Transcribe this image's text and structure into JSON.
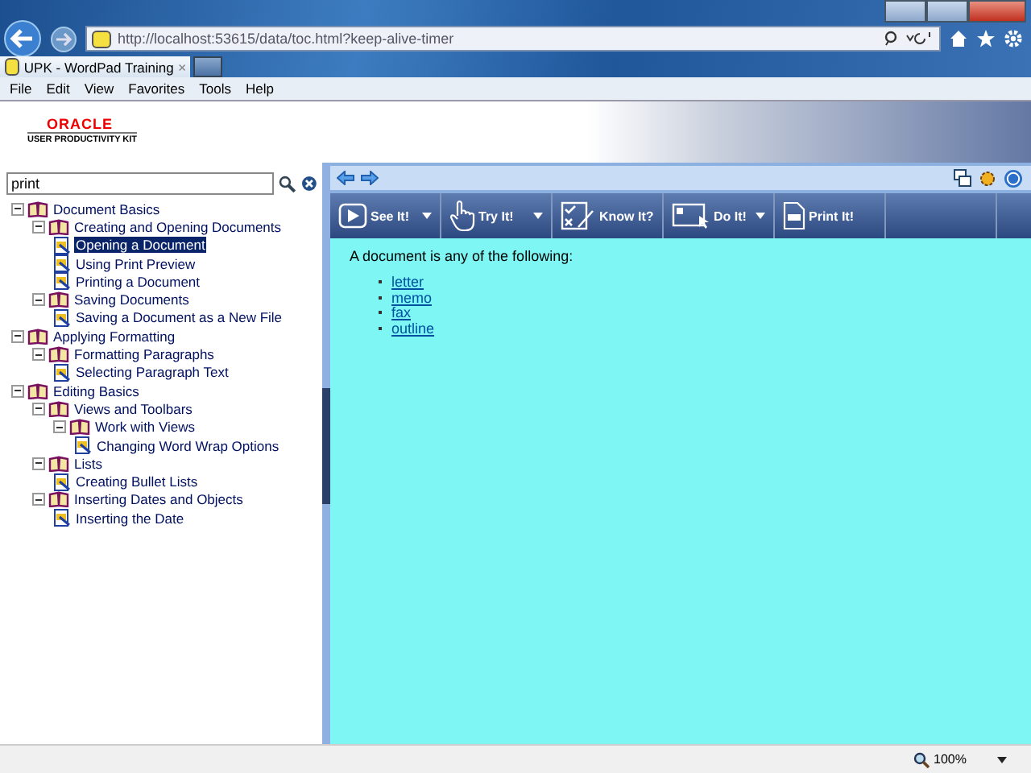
{
  "browser": {
    "address": "http://localhost:53615/data/toc.html?keep-alive-timer",
    "tab_title": "UPK - WordPad Training",
    "menu": [
      "File",
      "Edit",
      "View",
      "Favorites",
      "Tools",
      "Help"
    ]
  },
  "banner": {
    "logo": "ORACLE",
    "subtitle": "USER PRODUCTIVITY KIT"
  },
  "search": {
    "value": "print"
  },
  "tree": [
    {
      "label": "Document Basics",
      "kind": "book",
      "expanded": true,
      "selected": false,
      "children": [
        {
          "label": "Creating and Opening Documents",
          "kind": "book",
          "expanded": true,
          "selected": false,
          "children": [
            {
              "label": "Opening a Document",
              "kind": "topic",
              "selected": true
            },
            {
              "label": "Using Print Preview",
              "kind": "topic",
              "selected": false
            },
            {
              "label": "Printing a Document",
              "kind": "topic",
              "selected": false
            }
          ]
        },
        {
          "label": "Saving Documents",
          "kind": "book",
          "expanded": true,
          "selected": false,
          "children": [
            {
              "label": "Saving a Document as a New File",
              "kind": "topic",
              "selected": false
            }
          ]
        }
      ]
    },
    {
      "label": "Applying Formatting",
      "kind": "book",
      "expanded": true,
      "selected": false,
      "children": [
        {
          "label": "Formatting Paragraphs",
          "kind": "book",
          "expanded": true,
          "selected": false,
          "children": [
            {
              "label": "Selecting Paragraph Text",
              "kind": "topic",
              "selected": false
            }
          ]
        }
      ]
    },
    {
      "label": "Editing Basics",
      "kind": "book",
      "expanded": true,
      "selected": false,
      "children": [
        {
          "label": "Views and Toolbars",
          "kind": "book",
          "expanded": true,
          "selected": false,
          "children": [
            {
              "label": "Work with Views",
              "kind": "book",
              "expanded": true,
              "selected": false,
              "children": [
                {
                  "label": "Changing Word Wrap Options",
                  "kind": "topic",
                  "selected": false
                }
              ]
            }
          ]
        },
        {
          "label": "Lists",
          "kind": "book",
          "expanded": true,
          "selected": false,
          "children": [
            {
              "label": "Creating Bullet Lists",
              "kind": "topic",
              "selected": false
            }
          ]
        },
        {
          "label": "Inserting Dates and Objects",
          "kind": "book",
          "expanded": true,
          "selected": false,
          "children": [
            {
              "label": "Inserting the Date",
              "kind": "topic",
              "selected": false
            }
          ]
        }
      ]
    }
  ],
  "modes": [
    {
      "label": "See It!",
      "kind": "see",
      "dropdown": true
    },
    {
      "label": "Try It!",
      "kind": "try",
      "dropdown": true
    },
    {
      "label": "Know It?",
      "kind": "know",
      "dropdown": false
    },
    {
      "label": "Do It!",
      "kind": "do",
      "dropdown": true
    },
    {
      "label": "Print It!",
      "kind": "print",
      "dropdown": false
    }
  ],
  "content": {
    "intro": "A document is any of the following:",
    "links": [
      "letter",
      "memo",
      "fax",
      "outline"
    ]
  },
  "status_bar": {
    "zoom": "100%"
  }
}
